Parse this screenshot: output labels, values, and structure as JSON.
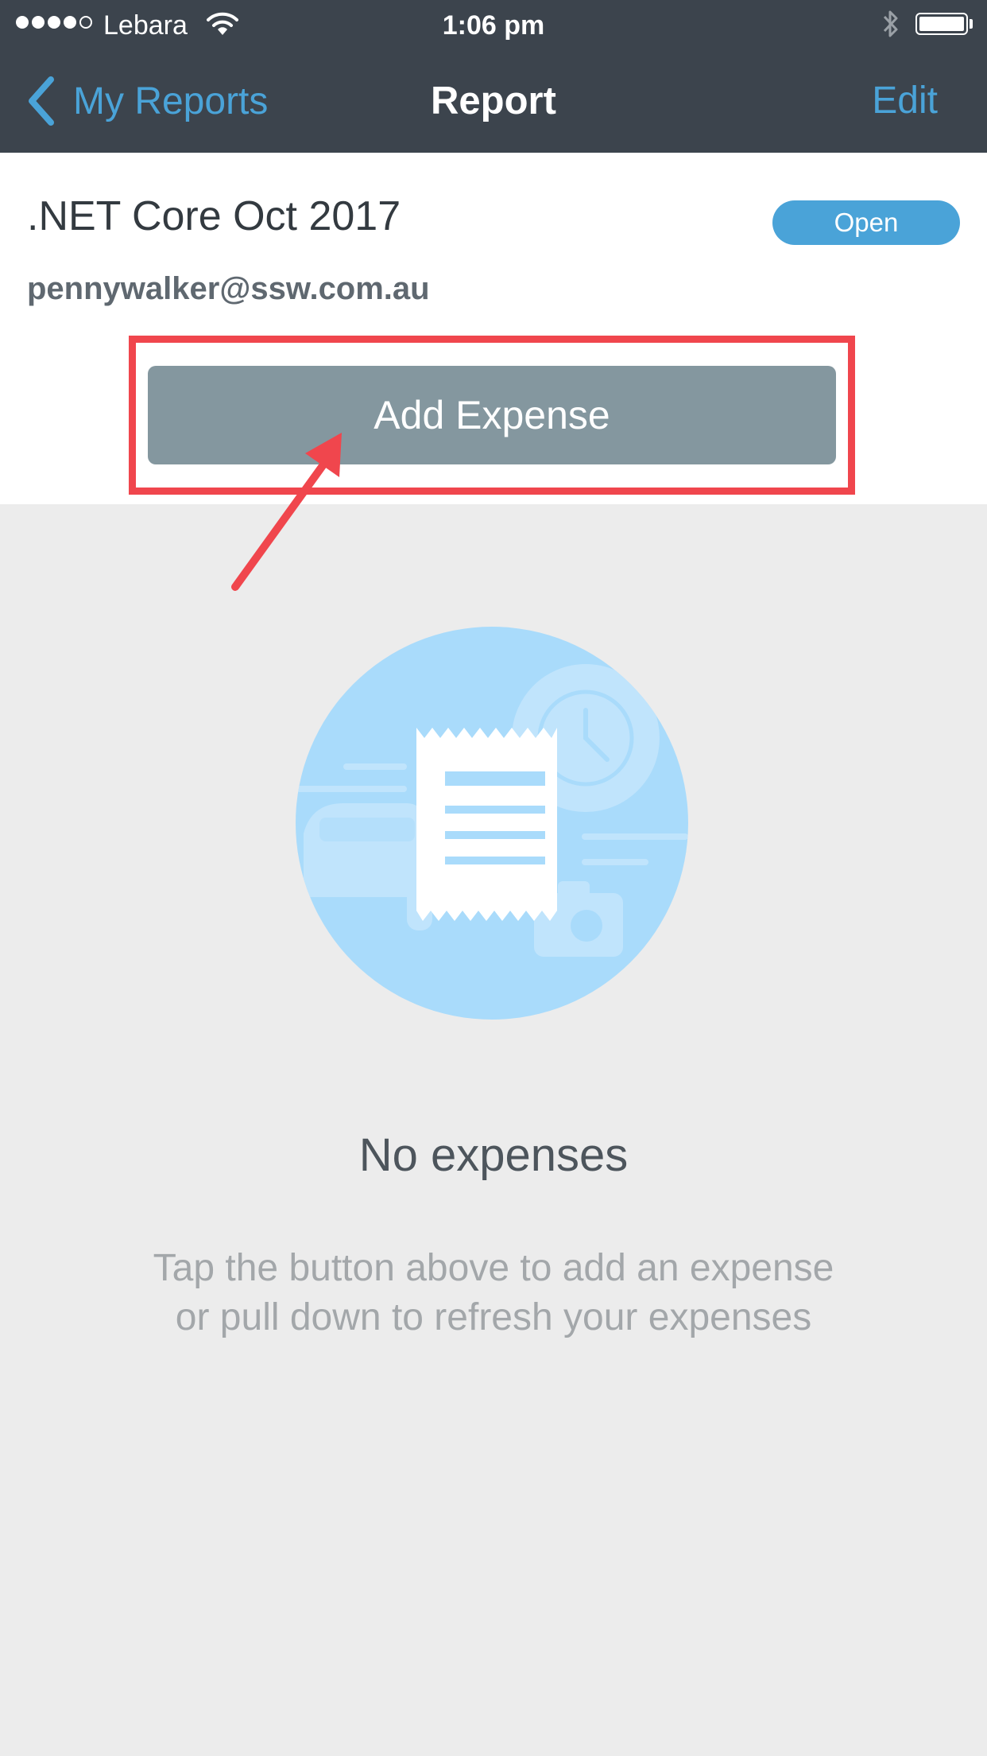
{
  "status_bar": {
    "carrier": "Lebara",
    "time": "1:06 pm"
  },
  "nav": {
    "back_label": "My Reports",
    "title": "Report",
    "edit_label": "Edit"
  },
  "report": {
    "name": ".NET Core Oct 2017",
    "status": "Open",
    "email": "pennywalker@ssw.com.au"
  },
  "actions": {
    "add_expense_label": "Add Expense"
  },
  "empty_state": {
    "title": "No expenses",
    "message_line1": "Tap the button above to add an expense",
    "message_line2": "or pull down to refresh your expenses"
  },
  "colors": {
    "nav_background": "#3c444d",
    "accent_blue": "#4aa3d8",
    "add_button": "#84979f",
    "highlight_red": "#f0464d",
    "illustration_circle": "#a9dbfb"
  },
  "icons": {
    "back": "chevron-left-icon",
    "wifi": "wifi-icon",
    "bluetooth": "bluetooth-icon",
    "battery": "battery-icon",
    "empty_state": "receipt-illustration"
  }
}
